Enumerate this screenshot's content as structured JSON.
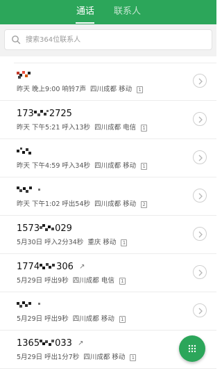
{
  "header": {
    "tabs": [
      {
        "label": "通话",
        "active": true
      },
      {
        "label": "联系人",
        "active": false
      }
    ],
    "accent_color": "#2ca65a"
  },
  "search": {
    "placeholder": "搜索364位联系人",
    "value": ""
  },
  "calls": [
    {
      "name": "",
      "name_redacted": true,
      "date": "昨天",
      "time": "晚上9:00",
      "detail": "响铃7声",
      "location": "四川成都",
      "carrier": "移动",
      "sim": "1",
      "outgoing_icon": false
    },
    {
      "name": "173",
      "name_suffix": "2725",
      "name_redacted": true,
      "date": "昨天",
      "time": "下午5:21",
      "detail": "呼入13秒",
      "location": "四川成都",
      "carrier": "电信",
      "sim": "1",
      "outgoing_icon": false
    },
    {
      "name": "",
      "name_redacted": true,
      "date": "昨天",
      "time": "下午4:59",
      "detail": "呼入34秒",
      "location": "四川成都",
      "carrier": "移动",
      "sim": "1",
      "outgoing_icon": false
    },
    {
      "name": "",
      "name_redacted": true,
      "date": "昨天",
      "time": "下午1:02",
      "detail": "呼出54秒",
      "location": "四川成都",
      "carrier": "移动",
      "sim": "2",
      "outgoing_icon": false
    },
    {
      "name": "1573",
      "name_suffix": "029",
      "name_redacted": true,
      "date": "5月30日",
      "time": "",
      "detail": "呼入2分34秒",
      "location": "重庆",
      "carrier": "移动",
      "sim": "1",
      "outgoing_icon": false
    },
    {
      "name": "1774",
      "name_suffix": "306",
      "name_redacted": true,
      "date": "5月29日",
      "time": "",
      "detail": "呼出9秒",
      "location": "四川成都",
      "carrier": "电信",
      "sim": "1",
      "outgoing_icon": true
    },
    {
      "name": "",
      "name_redacted": true,
      "date": "5月29日",
      "time": "",
      "detail": "呼出9秒",
      "location": "四川成都",
      "carrier": "移动",
      "sim": "1",
      "outgoing_icon": false
    },
    {
      "name": "1365",
      "name_suffix": "033",
      "name_redacted": true,
      "date": "5月29日",
      "time": "",
      "detail": "呼出1分7秒",
      "location": "四川成都",
      "carrier": "移动",
      "sim": "1",
      "outgoing_icon": true
    }
  ],
  "icons": {
    "search": "search-icon",
    "detail": "chevron-right-icon",
    "dialpad": "dialpad-icon",
    "outgoing": "outgoing-call-arrow-icon",
    "sim": "sim-card-icon"
  }
}
